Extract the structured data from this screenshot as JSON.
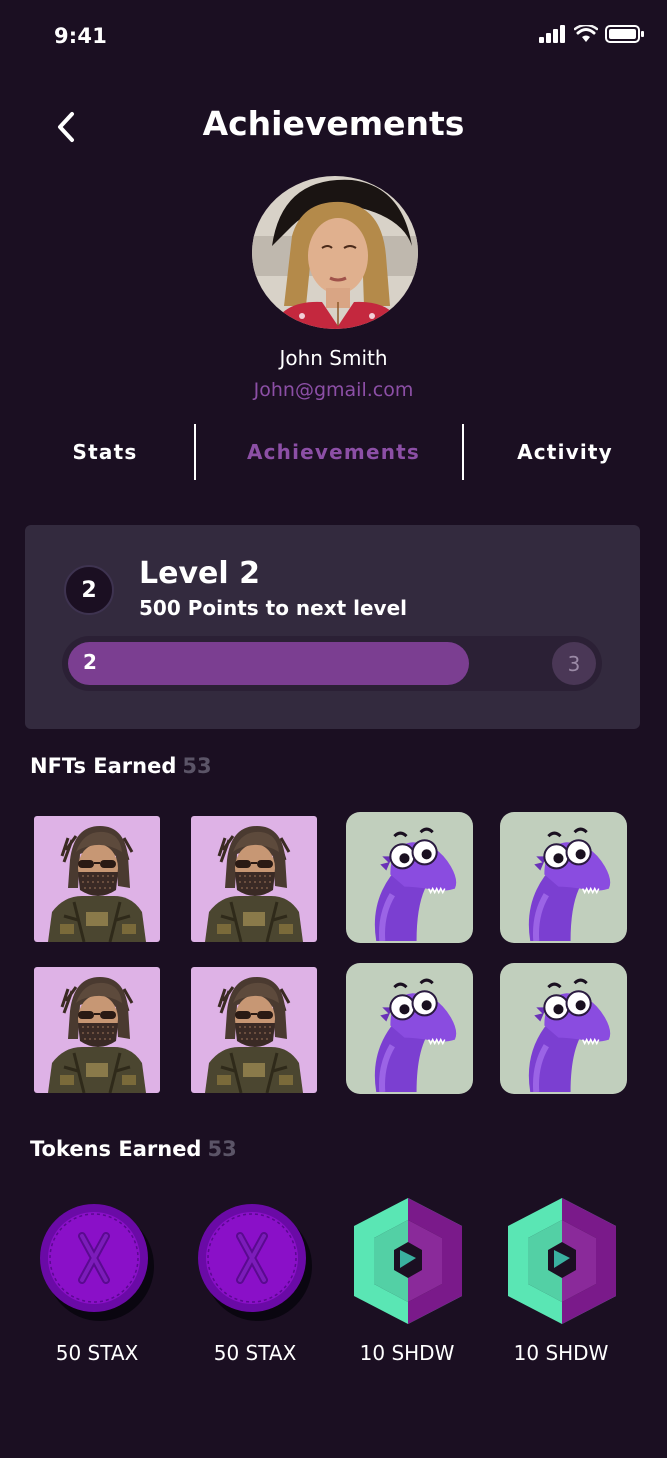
{
  "status_bar": {
    "time": "9:41",
    "icons": [
      "signal-icon",
      "wifi-icon",
      "battery-icon"
    ]
  },
  "header": {
    "title": "Achievements",
    "back_icon": "chevron-left-icon"
  },
  "profile": {
    "name": "John Smith",
    "email": "John@gmail.com"
  },
  "tabs": [
    {
      "label": "Stats",
      "active": false
    },
    {
      "label": "Achievements",
      "active": true
    },
    {
      "label": "Activity",
      "active": false
    }
  ],
  "level": {
    "badge": "2",
    "title": "Level 2",
    "subtitle": "500 Points to next level",
    "current": "2",
    "next": "3",
    "progress_percent": 76
  },
  "nfts": {
    "heading": "NFTs Earned",
    "count": "53",
    "items": [
      {
        "kind": "masked-character"
      },
      {
        "kind": "masked-character"
      },
      {
        "kind": "purple-dino"
      },
      {
        "kind": "purple-dino"
      },
      {
        "kind": "masked-character"
      },
      {
        "kind": "masked-character"
      },
      {
        "kind": "purple-dino"
      },
      {
        "kind": "purple-dino"
      }
    ]
  },
  "tokens": {
    "heading": "Tokens Earned",
    "count": "53",
    "items": [
      {
        "label": "50 STAX",
        "icon": "stax-coin-icon"
      },
      {
        "label": "50 STAX",
        "icon": "stax-coin-icon"
      },
      {
        "label": "10 SHDW",
        "icon": "shdw-token-icon"
      },
      {
        "label": "10 SHDW",
        "icon": "shdw-token-icon"
      }
    ]
  },
  "colors": {
    "background": "#1b0f22",
    "accent": "#8c4fa6",
    "card": "#332a3e",
    "progress": "#7b3e91"
  }
}
